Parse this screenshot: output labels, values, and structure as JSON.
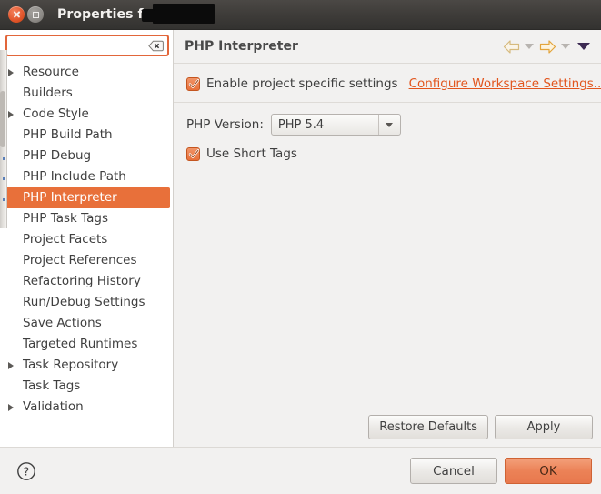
{
  "window": {
    "title": "Properties for ha",
    "title_redacted": true,
    "close_label": "Close",
    "maximize_label": "Maximize"
  },
  "sidebar": {
    "filter": {
      "value": "",
      "placeholder": "",
      "clear_icon": "clear-text-icon"
    },
    "items": [
      {
        "label": "Resource",
        "expandable": true,
        "selected": false
      },
      {
        "label": "Builders",
        "expandable": false,
        "selected": false
      },
      {
        "label": "Code Style",
        "expandable": true,
        "selected": false
      },
      {
        "label": "PHP Build Path",
        "expandable": false,
        "selected": false
      },
      {
        "label": "PHP Debug",
        "expandable": false,
        "selected": false
      },
      {
        "label": "PHP Include Path",
        "expandable": false,
        "selected": false
      },
      {
        "label": "PHP Interpreter",
        "expandable": false,
        "selected": true
      },
      {
        "label": "PHP Task Tags",
        "expandable": false,
        "selected": false
      },
      {
        "label": "Project Facets",
        "expandable": false,
        "selected": false
      },
      {
        "label": "Project References",
        "expandable": false,
        "selected": false
      },
      {
        "label": "Refactoring History",
        "expandable": false,
        "selected": false
      },
      {
        "label": "Run/Debug Settings",
        "expandable": false,
        "selected": false
      },
      {
        "label": "Save Actions",
        "expandable": false,
        "selected": false
      },
      {
        "label": "Targeted Runtimes",
        "expandable": false,
        "selected": false
      },
      {
        "label": "Task Repository",
        "expandable": true,
        "selected": false
      },
      {
        "label": "Task Tags",
        "expandable": false,
        "selected": false
      },
      {
        "label": "Validation",
        "expandable": true,
        "selected": false
      }
    ]
  },
  "panel": {
    "title": "PHP Interpreter",
    "nav": {
      "back_icon": "back-arrow-icon",
      "back_menu_icon": "chevron-down-icon",
      "forward_icon": "forward-arrow-icon",
      "forward_menu_icon": "chevron-down-icon",
      "view_menu_icon": "view-menu-icon"
    },
    "enable_specific": {
      "label": "Enable project specific settings",
      "checked": true
    },
    "workspace_link": "Configure Workspace Settings...",
    "php_version": {
      "label": "PHP Version:",
      "value": "PHP 5.4",
      "options": [
        "PHP 5.4"
      ]
    },
    "short_tags": {
      "label": "Use Short Tags",
      "checked": true
    },
    "restore_defaults_label": "Restore Defaults",
    "apply_label": "Apply"
  },
  "footer": {
    "help_icon": "help-icon",
    "cancel_label": "Cancel",
    "ok_label": "OK"
  },
  "colors": {
    "accent": "#e8703a",
    "link": "#e2561e",
    "titlebar": "#3d3b38",
    "panel_bg": "#f2f1f0",
    "tree_bg": "#ffffff"
  }
}
